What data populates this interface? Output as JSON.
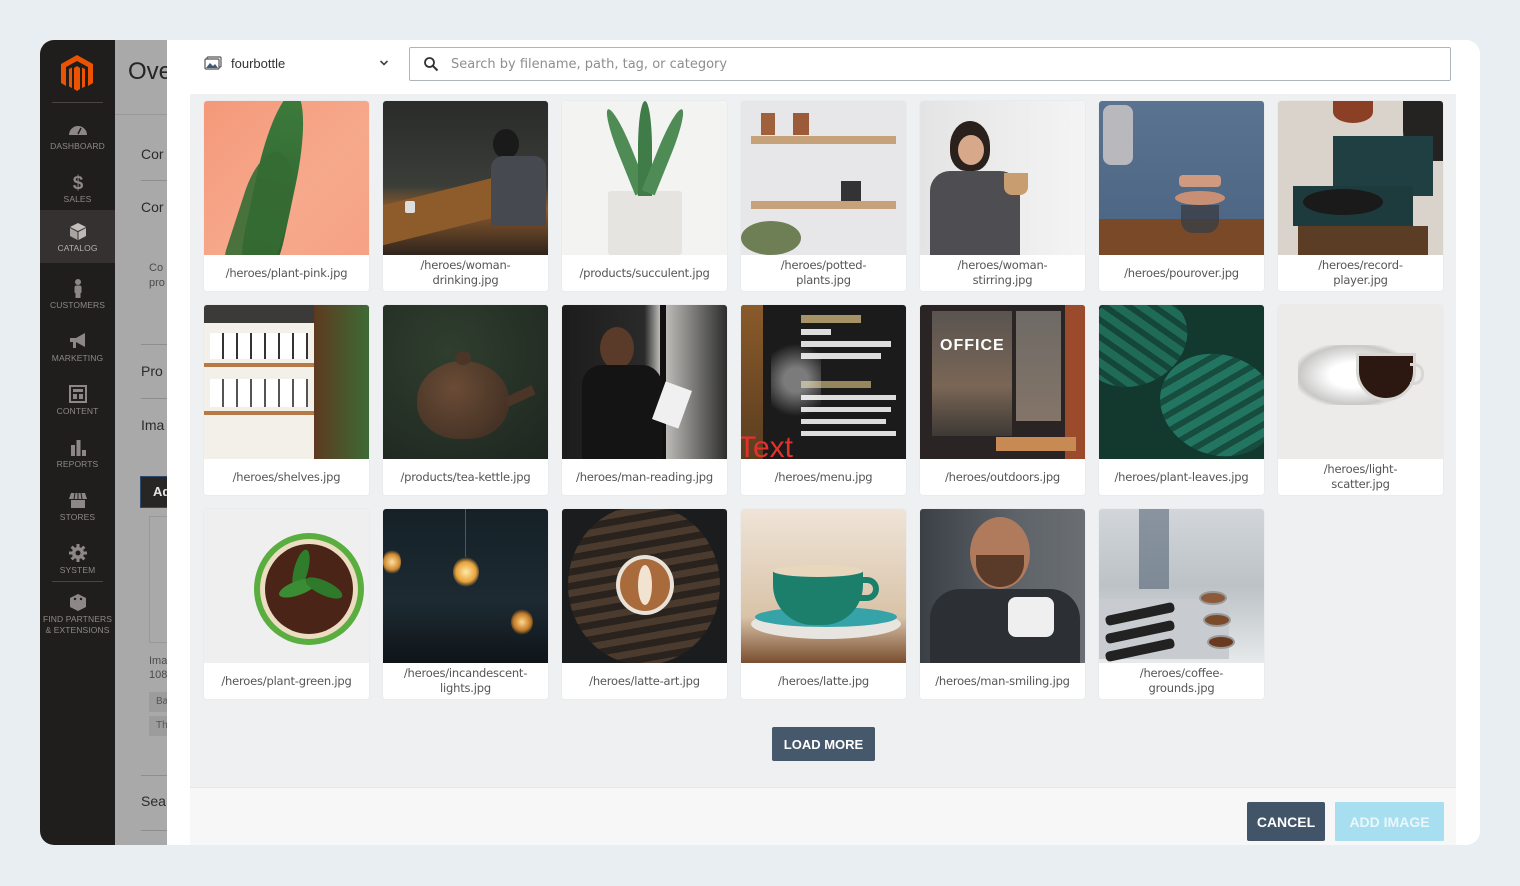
{
  "admin": {
    "sidebar": {
      "items": [
        {
          "label": "DASHBOARD",
          "icon": "dashboard-gauge-icon",
          "active": false
        },
        {
          "label": "SALES",
          "icon": "dollar-icon",
          "active": false
        },
        {
          "label": "CATALOG",
          "icon": "box-icon",
          "active": true
        },
        {
          "label": "CUSTOMERS",
          "icon": "person-icon",
          "active": false
        },
        {
          "label": "MARKETING",
          "icon": "megaphone-icon",
          "active": false
        },
        {
          "label": "CONTENT",
          "icon": "layout-icon",
          "active": false
        },
        {
          "label": "REPORTS",
          "icon": "bar-chart-icon",
          "active": false
        },
        {
          "label": "STORES",
          "icon": "storefront-icon",
          "active": false
        },
        {
          "label": "SYSTEM",
          "icon": "gear-icon",
          "active": false
        },
        {
          "label": "FIND PARTNERS & EXTENSIONS",
          "label_line1": "FIND PARTNERS",
          "label_line2": "& EXTENSIONS",
          "icon": "extensions-box-icon",
          "active": false
        }
      ]
    },
    "page_behind": {
      "title": "Ove",
      "sections": [
        "Cor",
        "Cor",
        "Pro",
        "Ima",
        "Sea"
      ],
      "snippet_line1": "Co",
      "snippet_line2": "pro",
      "add_button": "Ad",
      "image_info_line1": "Ima",
      "image_info_line2": "108",
      "chip1": "Ba",
      "chip2": "Th"
    }
  },
  "modal": {
    "source_select": {
      "value": "fourbottle",
      "icon": "image-library-icon"
    },
    "search": {
      "placeholder": "Search by filename, path, tag, or category",
      "value": ""
    },
    "images": [
      {
        "path": "/heroes/plant-pink.jpg",
        "theme": "plant-pink"
      },
      {
        "path": "/heroes/woman-drinking.jpg",
        "theme": "woman-drinking"
      },
      {
        "path": "/products/succulent.jpg",
        "theme": "succulent"
      },
      {
        "path": "/heroes/potted-plants.jpg",
        "theme": "potted-plants"
      },
      {
        "path": "/heroes/woman-stirring.jpg",
        "theme": "woman-stirring"
      },
      {
        "path": "/heroes/pourover.jpg",
        "theme": "pourover"
      },
      {
        "path": "/heroes/record-player.jpg",
        "theme": "record-player"
      },
      {
        "path": "/heroes/shelves.jpg",
        "theme": "shelves"
      },
      {
        "path": "/products/tea-kettle.jpg",
        "theme": "tea-kettle"
      },
      {
        "path": "/heroes/man-reading.jpg",
        "theme": "man-reading"
      },
      {
        "path": "/heroes/menu.jpg",
        "theme": "menu",
        "overlay_text": "Text"
      },
      {
        "path": "/heroes/outdoors.jpg",
        "theme": "outdoors"
      },
      {
        "path": "/heroes/plant-leaves.jpg",
        "theme": "plant-leaves"
      },
      {
        "path": "/heroes/light-scatter.jpg",
        "theme": "light-scatter"
      },
      {
        "path": "/heroes/plant-green.jpg",
        "theme": "plant-green"
      },
      {
        "path": "/heroes/incandescent-lights.jpg",
        "theme": "incandescent-lights"
      },
      {
        "path": "/heroes/latte-art.jpg",
        "theme": "latte-art"
      },
      {
        "path": "/heroes/latte.jpg",
        "theme": "latte"
      },
      {
        "path": "/heroes/man-smiling.jpg",
        "theme": "man-smiling"
      },
      {
        "path": "/heroes/coffee-grounds.jpg",
        "theme": "coffee-grounds"
      }
    ],
    "load_more_label": "LOAD MORE",
    "cancel_label": "CANCEL",
    "add_image_label": "ADD IMAGE",
    "add_image_enabled": false
  },
  "colors": {
    "magento_orange": "#eb5202",
    "sidebar_bg": "#1f1e1d",
    "button_dark": "#46586b",
    "add_image_disabled": "#a8dff0",
    "overlay_text": "#e4312b"
  }
}
